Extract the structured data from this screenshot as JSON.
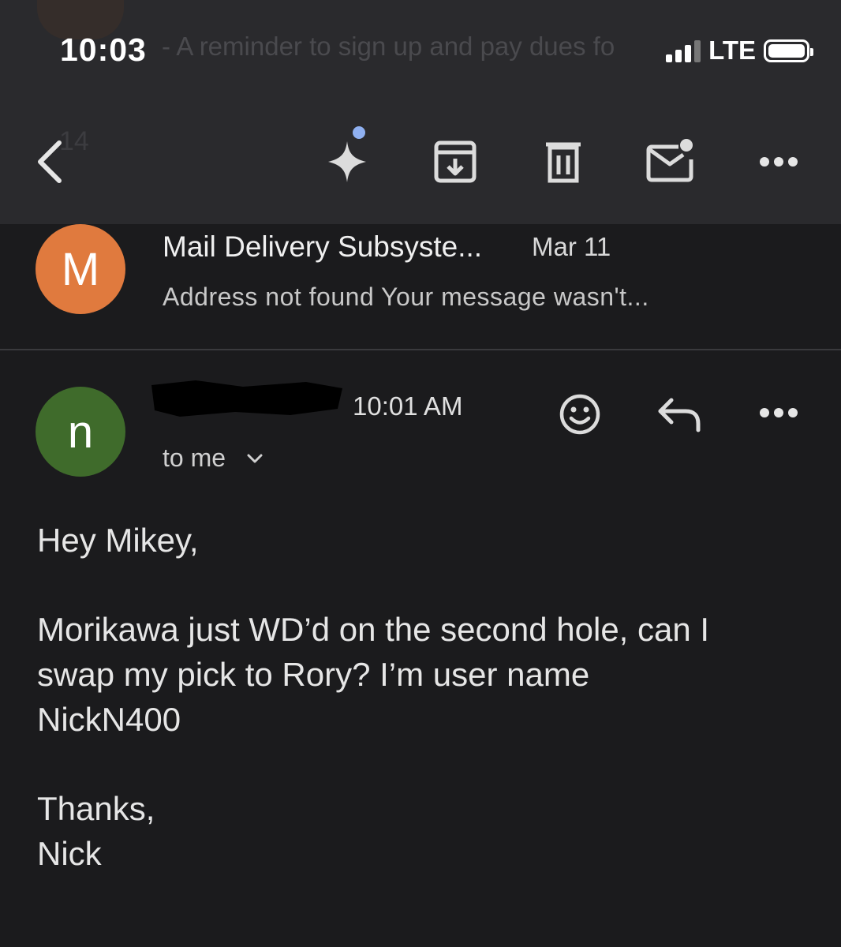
{
  "status_bar": {
    "time": "10:03",
    "network": "LTE"
  },
  "background_list": {
    "faded_snippet": "- A reminder to sign up and pay dues fo",
    "faded_count": "14"
  },
  "toolbar": {
    "back_icon": "chevron-left-icon",
    "gemini_icon": "sparkle-icon",
    "archive_icon": "archive-icon",
    "delete_icon": "trash-icon",
    "mark_unread_icon": "mail-unread-icon",
    "more_icon": "more-horizontal-icon"
  },
  "preview": {
    "avatar_letter": "M",
    "avatar_color": "#e07a3e",
    "sender": "Mail Delivery Subsyste...",
    "date": "Mar 11",
    "snippet": "Address not found Your message wasn't..."
  },
  "message": {
    "avatar_letter": "n",
    "avatar_color": "#3f6b2b",
    "time": "10:01 AM",
    "to": "to me",
    "greeting": "Hey Mikey,",
    "body_lines": [
      "Morikawa just WD’d on the second hole, can I",
      "swap my pick to Rory? I’m user name",
      "NickN400"
    ],
    "signoff": "Thanks,",
    "signature": "Nick"
  }
}
